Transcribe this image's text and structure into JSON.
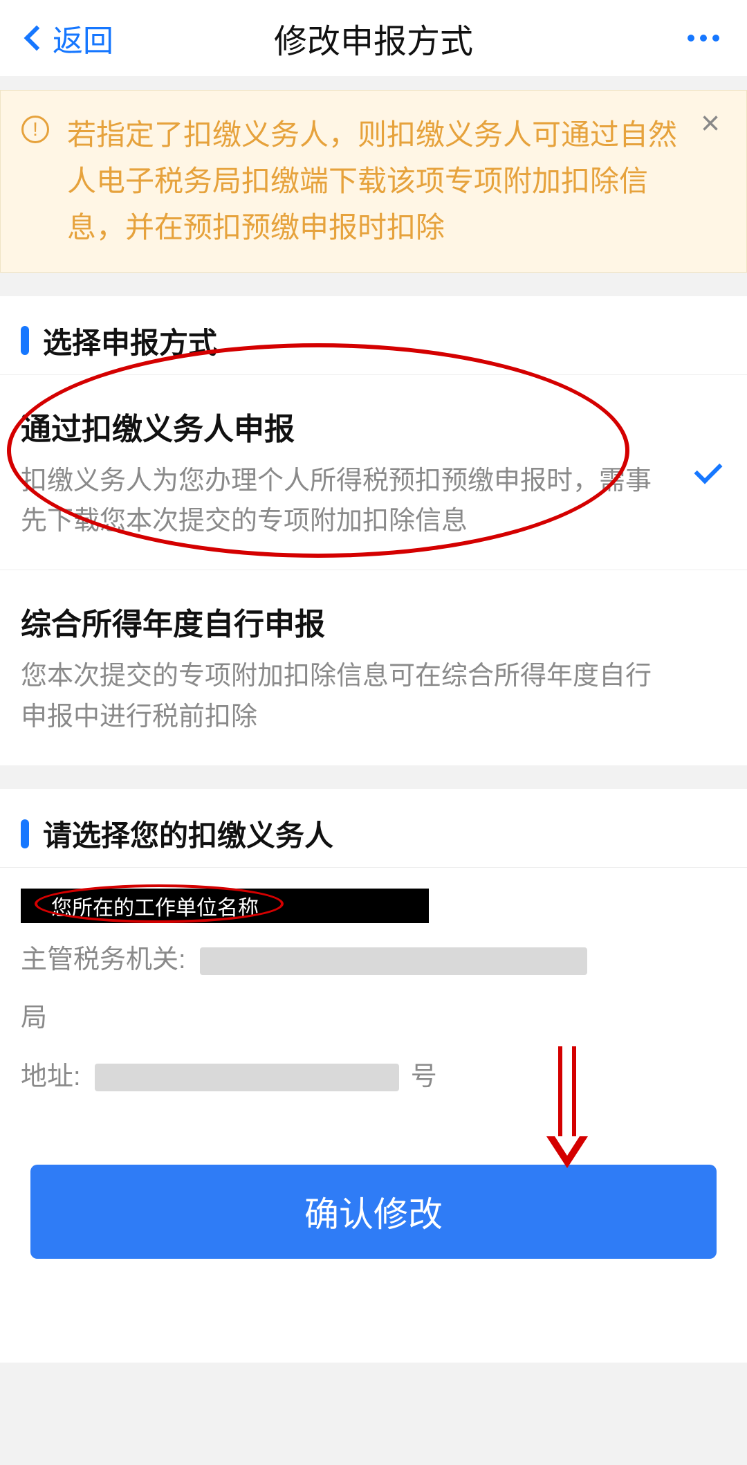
{
  "nav": {
    "back_label": "返回",
    "title": "修改申报方式"
  },
  "notice": {
    "text": "若指定了扣缴义务人，则扣缴义务人可通过自然人电子税务局扣缴端下载该项专项附加扣除信息，并在预扣预缴申报时扣除"
  },
  "sections": {
    "method": {
      "title": "选择申报方式",
      "options": [
        {
          "title": "通过扣缴义务人申报",
          "desc": "扣缴义务人为您办理个人所得税预扣预缴申报时，需事先下载您本次提交的专项附加扣除信息",
          "selected": true
        },
        {
          "title": "综合所得年度自行申报",
          "desc": "您本次提交的专项附加扣除信息可在综合所得年度自行申报中进行税前扣除",
          "selected": false
        }
      ]
    },
    "employer": {
      "title": "请选择您的扣缴义务人",
      "name_placeholder": "您所在的工作单位名称",
      "tax_authority_label": "主管税务机关:",
      "tax_authority_suffix": "局",
      "address_label": "地址:",
      "address_suffix": "号"
    }
  },
  "confirm_label": "确认修改"
}
